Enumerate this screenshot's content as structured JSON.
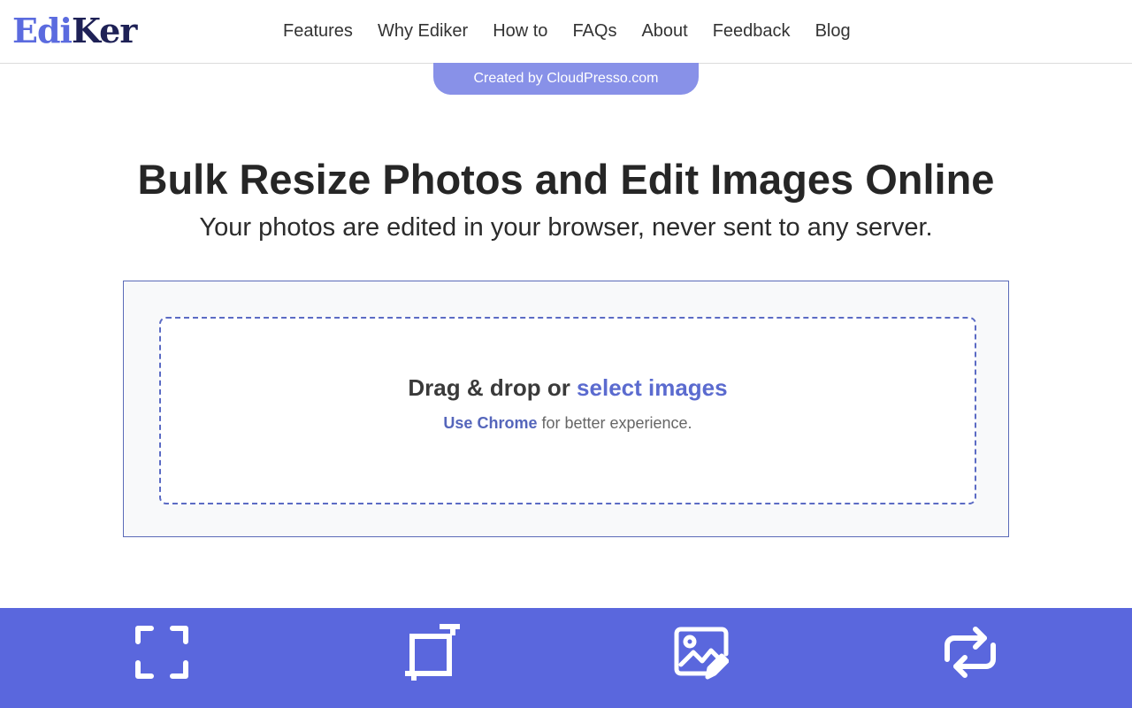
{
  "logo": {
    "part1": "Edi",
    "part2": "Ker"
  },
  "nav": [
    "Features",
    "Why Ediker",
    "How to",
    "FAQs",
    "About",
    "Feedback",
    "Blog"
  ],
  "credit": "Created by CloudPresso.com",
  "hero": {
    "title": "Bulk Resize Photos and Edit Images Online",
    "subtitle": "Your photos are edited in your browser, never sent to any server."
  },
  "upload": {
    "prefix": "Drag & drop or ",
    "link": "select images",
    "hint_link": "Use Chrome",
    "hint_rest": " for better experience."
  },
  "features": [
    {
      "icon": "expand-icon"
    },
    {
      "icon": "crop-icon"
    },
    {
      "icon": "image-edit-icon"
    },
    {
      "icon": "convert-arrows-icon"
    }
  ],
  "colors": {
    "accent": "#5a67dd",
    "brand_dark": "#1e2156",
    "link": "#5b6bcf",
    "credit_bg": "#8891e8"
  }
}
